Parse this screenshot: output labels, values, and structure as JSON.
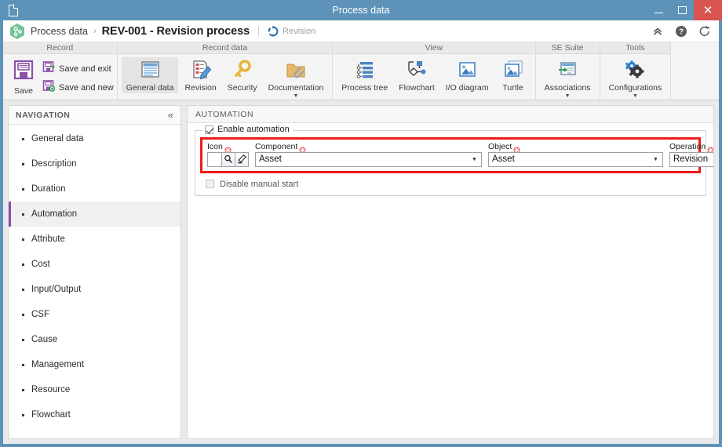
{
  "window": {
    "title": "Process data",
    "doc_icon": "document-icon",
    "controls": {
      "minimize": "minimize-button",
      "maximize": "maximize-button",
      "close": "close-button"
    }
  },
  "header": {
    "app_icon": "process-hexagon-icon",
    "breadcrumb_root": "Process data",
    "breadcrumb_separator": "›",
    "breadcrumb_title": "REV-001 - Revision process",
    "status_icon": "revision-cycle-icon",
    "status_label": "Revision",
    "actions": {
      "collapse": "collapse-chevrons-icon",
      "help": "help-icon",
      "refresh": "refresh-icon"
    }
  },
  "ribbon": {
    "groups": [
      {
        "title": "Record",
        "type": "save",
        "main": {
          "label": "Save",
          "icon": "floppy-disk-icon"
        },
        "side": [
          {
            "label": "Save and exit",
            "icon": "save-exit-icon"
          },
          {
            "label": "Save and new",
            "icon": "save-new-icon"
          }
        ]
      },
      {
        "title": "Record data",
        "type": "buttons",
        "buttons": [
          {
            "label": "General data",
            "icon": "general-data-icon",
            "active": true,
            "caret": false
          },
          {
            "label": "Revision",
            "icon": "revision-edit-icon",
            "active": false,
            "caret": false
          },
          {
            "label": "Security",
            "icon": "key-icon",
            "active": false,
            "caret": false
          },
          {
            "label": "Documentation",
            "icon": "folder-attachment-icon",
            "active": false,
            "caret": true
          }
        ]
      },
      {
        "title": "View",
        "type": "buttons",
        "buttons": [
          {
            "label": "Process tree",
            "icon": "process-tree-icon",
            "active": false,
            "caret": false
          },
          {
            "label": "Flowchart",
            "icon": "flowchart-icon",
            "active": false,
            "caret": false
          },
          {
            "label": "I/O diagram",
            "icon": "io-diagram-icon",
            "active": false,
            "caret": false
          },
          {
            "label": "Turtle",
            "icon": "turtle-diagram-icon",
            "active": false,
            "caret": false
          }
        ]
      },
      {
        "title": "SE Suite",
        "type": "buttons",
        "buttons": [
          {
            "label": "Associations",
            "icon": "associations-icon",
            "active": false,
            "caret": true
          }
        ]
      },
      {
        "title": "Tools",
        "type": "buttons",
        "buttons": [
          {
            "label": "Configurations",
            "icon": "gears-icon",
            "active": false,
            "caret": true
          }
        ]
      }
    ]
  },
  "navigation": {
    "title": "NAVIGATION",
    "collapse_icon": "collapse-left-icon",
    "items": [
      {
        "label": "General data",
        "selected": false
      },
      {
        "label": "Description",
        "selected": false
      },
      {
        "label": "Duration",
        "selected": false
      },
      {
        "label": "Automation",
        "selected": true
      },
      {
        "label": "Attribute",
        "selected": false
      },
      {
        "label": "Cost",
        "selected": false
      },
      {
        "label": "Input/Output",
        "selected": false
      },
      {
        "label": "CSF",
        "selected": false
      },
      {
        "label": "Cause",
        "selected": false
      },
      {
        "label": "Management",
        "selected": false
      },
      {
        "label": "Resource",
        "selected": false
      },
      {
        "label": "Flowchart",
        "selected": false
      }
    ]
  },
  "main": {
    "panel_title": "AUTOMATION",
    "enable_automation": {
      "label": "Enable automation",
      "checked": true
    },
    "highlight_color": "#ef1c1c",
    "fields": {
      "icon": {
        "label": "Icon",
        "required": true,
        "value": "",
        "search_icon": "magnifier-icon",
        "clear_icon": "eraser-icon"
      },
      "component": {
        "label": "Component",
        "required": true,
        "value": "Asset",
        "arrow": "▼"
      },
      "object": {
        "label": "Object",
        "required": true,
        "value": "Asset",
        "arrow": "▼"
      },
      "operation": {
        "label": "Operation",
        "required": true,
        "value": "Revision",
        "arrow": "▼"
      }
    },
    "disable_manual_start": {
      "label": "Disable manual start",
      "checked": false
    }
  }
}
